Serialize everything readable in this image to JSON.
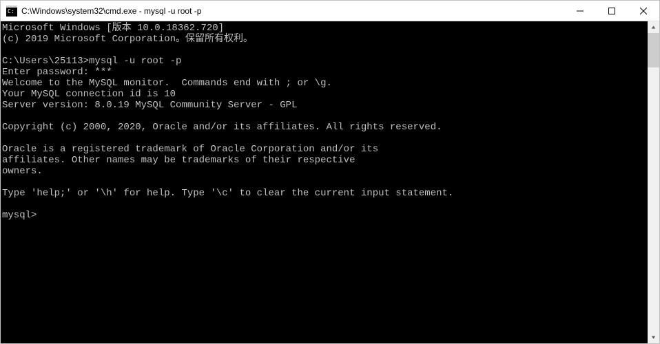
{
  "titlebar": {
    "title": "C:\\Windows\\system32\\cmd.exe - mysql  -u root -p"
  },
  "terminal": {
    "lines": [
      "Microsoft Windows [版本 10.0.18362.720]",
      "(c) 2019 Microsoft Corporation。保留所有权利。",
      "",
      "C:\\Users\\25113>mysql -u root -p",
      "Enter password: ***",
      "Welcome to the MySQL monitor.  Commands end with ; or \\g.",
      "Your MySQL connection id is 10",
      "Server version: 8.0.19 MySQL Community Server - GPL",
      "",
      "Copyright (c) 2000, 2020, Oracle and/or its affiliates. All rights reserved.",
      "",
      "Oracle is a registered trademark of Oracle Corporation and/or its",
      "affiliates. Other names may be trademarks of their respective",
      "owners.",
      "",
      "Type 'help;' or '\\h' for help. Type '\\c' to clear the current input statement.",
      "",
      "mysql>"
    ]
  }
}
